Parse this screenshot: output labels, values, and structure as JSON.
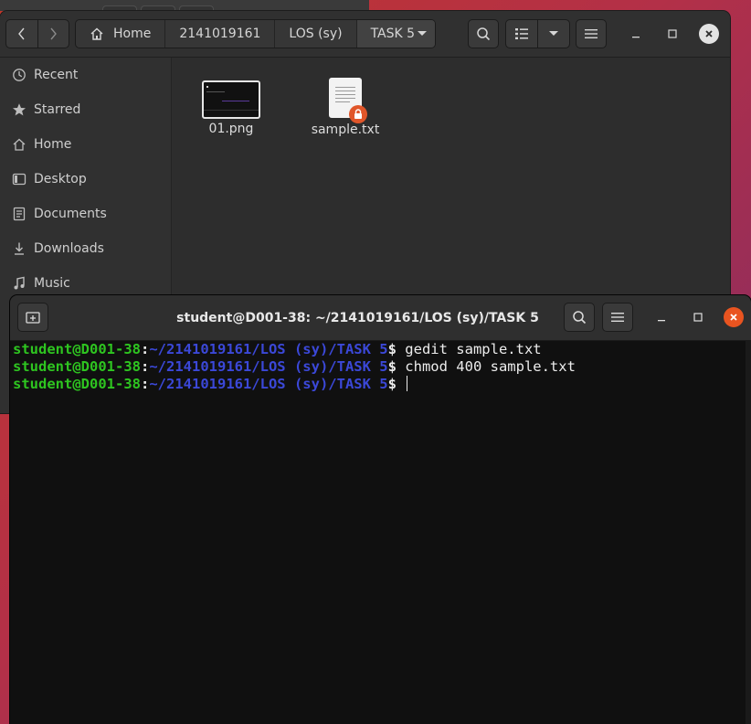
{
  "files": {
    "breadcrumbs": [
      "Home",
      "2141019161",
      "LOS (sy)",
      "TASK 5"
    ],
    "sidebar": {
      "items": [
        {
          "label": "Recent",
          "icon": "clock-icon"
        },
        {
          "label": "Starred",
          "icon": "star-icon"
        },
        {
          "label": "Home",
          "icon": "home-icon"
        },
        {
          "label": "Desktop",
          "icon": "desktop-icon"
        },
        {
          "label": "Documents",
          "icon": "document-icon"
        },
        {
          "label": "Downloads",
          "icon": "download-icon"
        },
        {
          "label": "Music",
          "icon": "music-icon"
        }
      ]
    },
    "items": [
      {
        "name": "01.png",
        "type": "image"
      },
      {
        "name": "sample.txt",
        "type": "text",
        "badge": "lock-icon"
      }
    ]
  },
  "terminal": {
    "title": "student@D001-38: ~/2141019161/LOS (sy)/TASK 5",
    "prompt_user": "student@D001-38",
    "prompt_path": "~/2141019161/LOS (sy)/TASK 5",
    "lines": [
      {
        "command": "gedit sample.txt"
      },
      {
        "command": "chmod 400 sample.txt"
      },
      {
        "command": ""
      }
    ]
  },
  "colors": {
    "prompt_user": "#2ec520",
    "prompt_path": "#3b48d8",
    "terminal_close": "#e95420",
    "lock_badge": "#e0562a"
  }
}
